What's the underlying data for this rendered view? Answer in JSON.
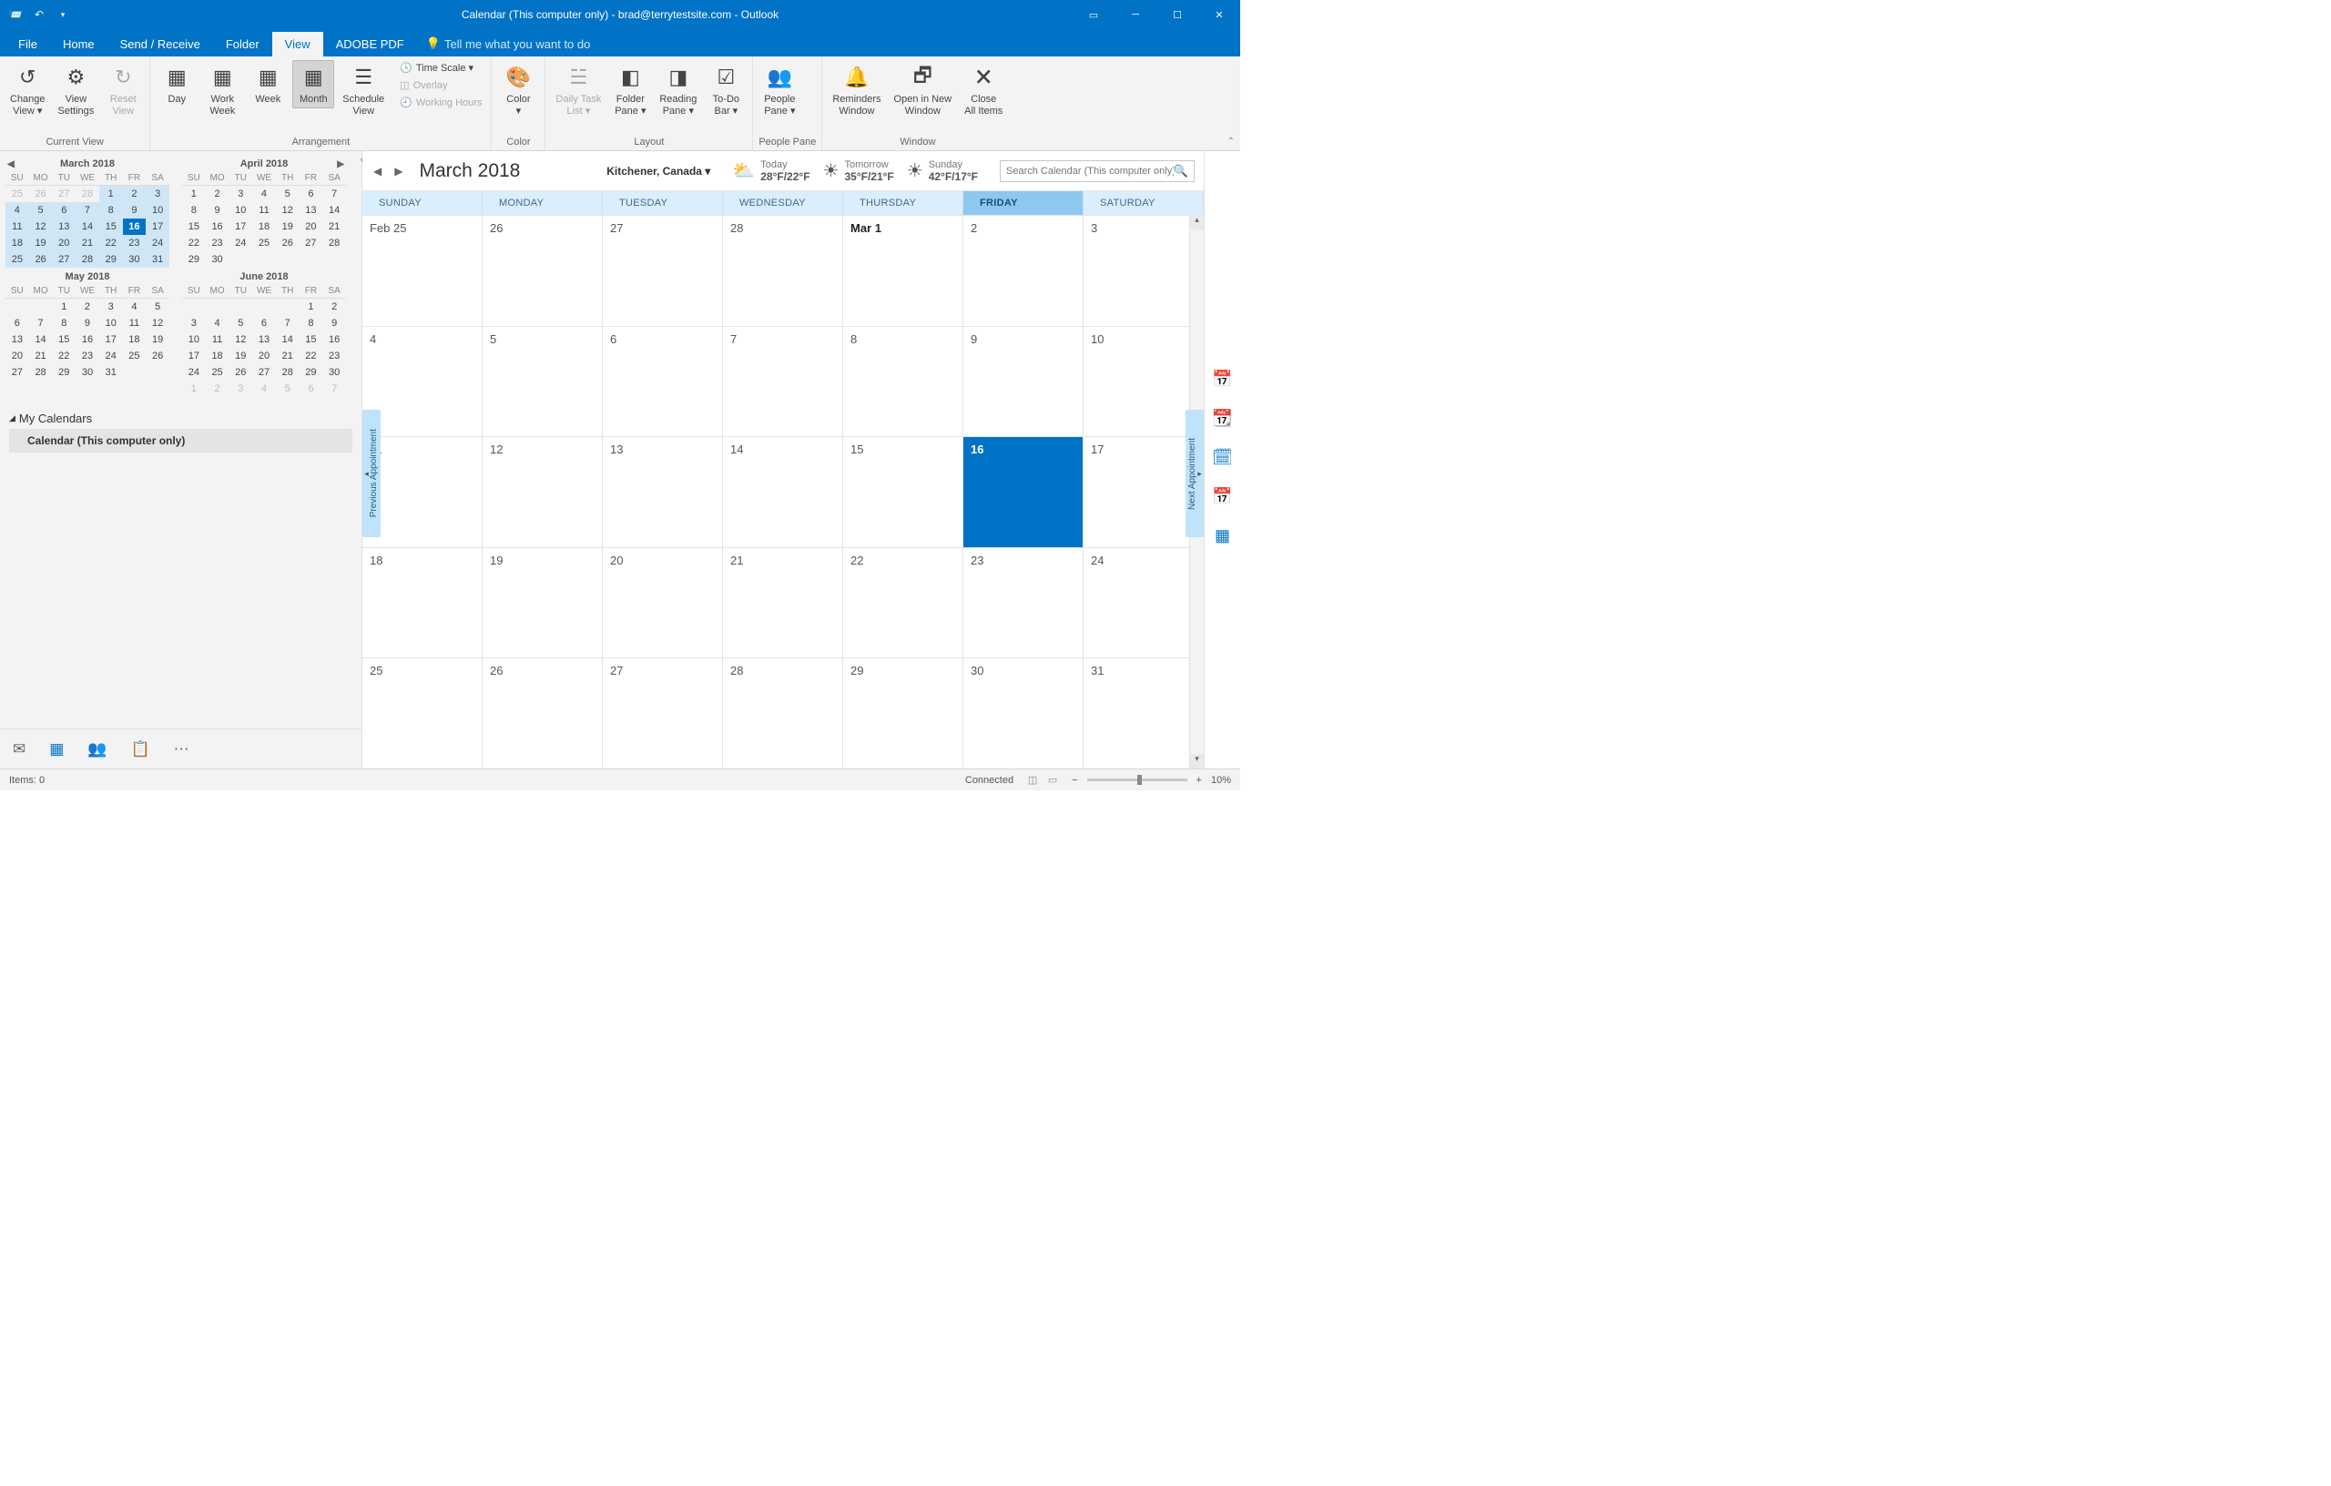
{
  "titlebar": {
    "title": "Calendar (This computer only) - brad@terrytestsite.com  -  Outlook"
  },
  "menu": {
    "file": "File",
    "home": "Home",
    "sendrecv": "Send / Receive",
    "folder": "Folder",
    "view": "View",
    "adobe": "ADOBE PDF",
    "tell": "Tell me what you want to do"
  },
  "ribbon": {
    "currentview": {
      "change": "Change\nView ▾",
      "settings": "View\nSettings",
      "reset": "Reset\nView",
      "label": "Current View"
    },
    "arrangement": {
      "day": "Day",
      "workweek": "Work\nWeek",
      "week": "Week",
      "month": "Month",
      "schedule": "Schedule\nView",
      "timescale": "Time Scale ▾",
      "overlay": "Overlay",
      "working": "Working Hours",
      "label": "Arrangement"
    },
    "color": {
      "color": "Color\n▾",
      "label": "Color"
    },
    "layout": {
      "daily": "Daily Task\nList ▾",
      "folder": "Folder\nPane ▾",
      "reading": "Reading\nPane ▾",
      "todo": "To-Do\nBar ▾",
      "label": "Layout"
    },
    "people": {
      "people": "People\nPane ▾",
      "label": "People Pane"
    },
    "window": {
      "reminders": "Reminders\nWindow",
      "opennew": "Open in New\nWindow",
      "closeall": "Close\nAll Items",
      "label": "Window"
    }
  },
  "minical": {
    "dow": [
      "SU",
      "MO",
      "TU",
      "WE",
      "TH",
      "FR",
      "SA"
    ],
    "months": [
      {
        "title": "March 2018",
        "navL": true,
        "cells": [
          {
            "n": "25",
            "c": "off"
          },
          {
            "n": "26",
            "c": "off"
          },
          {
            "n": "27",
            "c": "off"
          },
          {
            "n": "28",
            "c": "off"
          },
          {
            "n": "1",
            "c": "hl"
          },
          {
            "n": "2",
            "c": "hl"
          },
          {
            "n": "3",
            "c": "hl"
          },
          {
            "n": "4",
            "c": "hl"
          },
          {
            "n": "5",
            "c": "hl"
          },
          {
            "n": "6",
            "c": "hl"
          },
          {
            "n": "7",
            "c": "hl"
          },
          {
            "n": "8",
            "c": "hl"
          },
          {
            "n": "9",
            "c": "hl"
          },
          {
            "n": "10",
            "c": "hl"
          },
          {
            "n": "11",
            "c": "hl"
          },
          {
            "n": "12",
            "c": "hl"
          },
          {
            "n": "13",
            "c": "hl"
          },
          {
            "n": "14",
            "c": "hl"
          },
          {
            "n": "15",
            "c": "hl"
          },
          {
            "n": "16",
            "c": "today"
          },
          {
            "n": "17",
            "c": "hl"
          },
          {
            "n": "18",
            "c": "hl"
          },
          {
            "n": "19",
            "c": "hl"
          },
          {
            "n": "20",
            "c": "hl"
          },
          {
            "n": "21",
            "c": "hl"
          },
          {
            "n": "22",
            "c": "hl"
          },
          {
            "n": "23",
            "c": "hl"
          },
          {
            "n": "24",
            "c": "hl"
          },
          {
            "n": "25",
            "c": "hl"
          },
          {
            "n": "26",
            "c": "hl"
          },
          {
            "n": "27",
            "c": "hl"
          },
          {
            "n": "28",
            "c": "hl"
          },
          {
            "n": "29",
            "c": "hl"
          },
          {
            "n": "30",
            "c": "hl"
          },
          {
            "n": "31",
            "c": "hl"
          }
        ]
      },
      {
        "title": "April 2018",
        "navR": true,
        "cells": [
          {
            "n": "1"
          },
          {
            "n": "2"
          },
          {
            "n": "3"
          },
          {
            "n": "4"
          },
          {
            "n": "5"
          },
          {
            "n": "6"
          },
          {
            "n": "7"
          },
          {
            "n": "8"
          },
          {
            "n": "9"
          },
          {
            "n": "10"
          },
          {
            "n": "11"
          },
          {
            "n": "12"
          },
          {
            "n": "13"
          },
          {
            "n": "14"
          },
          {
            "n": "15"
          },
          {
            "n": "16"
          },
          {
            "n": "17"
          },
          {
            "n": "18"
          },
          {
            "n": "19"
          },
          {
            "n": "20"
          },
          {
            "n": "21"
          },
          {
            "n": "22"
          },
          {
            "n": "23"
          },
          {
            "n": "24"
          },
          {
            "n": "25"
          },
          {
            "n": "26"
          },
          {
            "n": "27"
          },
          {
            "n": "28"
          },
          {
            "n": "29"
          },
          {
            "n": "30"
          },
          {
            "n": ""
          },
          {
            "n": ""
          },
          {
            "n": ""
          },
          {
            "n": ""
          },
          {
            "n": ""
          }
        ]
      },
      {
        "title": "May 2018",
        "cells": [
          {
            "n": ""
          },
          {
            "n": ""
          },
          {
            "n": "1"
          },
          {
            "n": "2"
          },
          {
            "n": "3"
          },
          {
            "n": "4"
          },
          {
            "n": "5"
          },
          {
            "n": "6"
          },
          {
            "n": "7"
          },
          {
            "n": "8"
          },
          {
            "n": "9"
          },
          {
            "n": "10"
          },
          {
            "n": "11"
          },
          {
            "n": "12"
          },
          {
            "n": "13"
          },
          {
            "n": "14"
          },
          {
            "n": "15"
          },
          {
            "n": "16"
          },
          {
            "n": "17"
          },
          {
            "n": "18"
          },
          {
            "n": "19"
          },
          {
            "n": "20"
          },
          {
            "n": "21"
          },
          {
            "n": "22"
          },
          {
            "n": "23"
          },
          {
            "n": "24"
          },
          {
            "n": "25"
          },
          {
            "n": "26"
          },
          {
            "n": "27"
          },
          {
            "n": "28"
          },
          {
            "n": "29"
          },
          {
            "n": "30"
          },
          {
            "n": "31"
          },
          {
            "n": ""
          },
          {
            "n": ""
          }
        ]
      },
      {
        "title": "June 2018",
        "cells": [
          {
            "n": ""
          },
          {
            "n": ""
          },
          {
            "n": ""
          },
          {
            "n": ""
          },
          {
            "n": ""
          },
          {
            "n": "1"
          },
          {
            "n": "2"
          },
          {
            "n": "3"
          },
          {
            "n": "4"
          },
          {
            "n": "5"
          },
          {
            "n": "6"
          },
          {
            "n": "7"
          },
          {
            "n": "8"
          },
          {
            "n": "9"
          },
          {
            "n": "10"
          },
          {
            "n": "11"
          },
          {
            "n": "12"
          },
          {
            "n": "13"
          },
          {
            "n": "14"
          },
          {
            "n": "15"
          },
          {
            "n": "16"
          },
          {
            "n": "17"
          },
          {
            "n": "18"
          },
          {
            "n": "19"
          },
          {
            "n": "20"
          },
          {
            "n": "21"
          },
          {
            "n": "22"
          },
          {
            "n": "23"
          },
          {
            "n": "24"
          },
          {
            "n": "25"
          },
          {
            "n": "26"
          },
          {
            "n": "27"
          },
          {
            "n": "28"
          },
          {
            "n": "29"
          },
          {
            "n": "30"
          },
          {
            "n": "1",
            "c": "off"
          },
          {
            "n": "2",
            "c": "off"
          },
          {
            "n": "3",
            "c": "off"
          },
          {
            "n": "4",
            "c": "off"
          },
          {
            "n": "5",
            "c": "off"
          },
          {
            "n": "6",
            "c": "off"
          },
          {
            "n": "7",
            "c": "off"
          }
        ]
      }
    ]
  },
  "calsection": {
    "header": "My Calendars",
    "item": "Calendar (This computer only)"
  },
  "calhdr": {
    "month": "March 2018",
    "location": "Kitchener, Canada ▾",
    "wx": [
      {
        "day": "Today",
        "temp": "28°F/22°F",
        "icon": "⛅"
      },
      {
        "day": "Tomorrow",
        "temp": "35°F/21°F",
        "icon": "☀"
      },
      {
        "day": "Sunday",
        "temp": "42°F/17°F",
        "icon": "☀"
      }
    ],
    "search_ph": "Search Calendar (This computer only)"
  },
  "dow": [
    "SUNDAY",
    "MONDAY",
    "TUESDAY",
    "WEDNESDAY",
    "THURSDAY",
    "FRIDAY",
    "SATURDAY"
  ],
  "dow_today": 5,
  "grid": [
    [
      {
        "t": "Feb 25"
      },
      {
        "t": "26"
      },
      {
        "t": "27"
      },
      {
        "t": "28"
      },
      {
        "t": "Mar 1",
        "b": true
      },
      {
        "t": "2"
      },
      {
        "t": "3"
      }
    ],
    [
      {
        "t": "4"
      },
      {
        "t": "5"
      },
      {
        "t": "6"
      },
      {
        "t": "7"
      },
      {
        "t": "8"
      },
      {
        "t": "9"
      },
      {
        "t": "10"
      }
    ],
    [
      {
        "t": "11"
      },
      {
        "t": "12"
      },
      {
        "t": "13"
      },
      {
        "t": "14"
      },
      {
        "t": "15"
      },
      {
        "t": "16",
        "today": true
      },
      {
        "t": "17"
      }
    ],
    [
      {
        "t": "18"
      },
      {
        "t": "19"
      },
      {
        "t": "20"
      },
      {
        "t": "21"
      },
      {
        "t": "22"
      },
      {
        "t": "23"
      },
      {
        "t": "24"
      }
    ],
    [
      {
        "t": "25"
      },
      {
        "t": "26"
      },
      {
        "t": "27"
      },
      {
        "t": "28"
      },
      {
        "t": "29"
      },
      {
        "t": "30"
      },
      {
        "t": "31"
      }
    ]
  ],
  "appt": {
    "prev": "Previous Appointment",
    "next": "Next Appointment"
  },
  "status": {
    "items": "Items: 0",
    "connected": "Connected",
    "zoom": "10%"
  }
}
